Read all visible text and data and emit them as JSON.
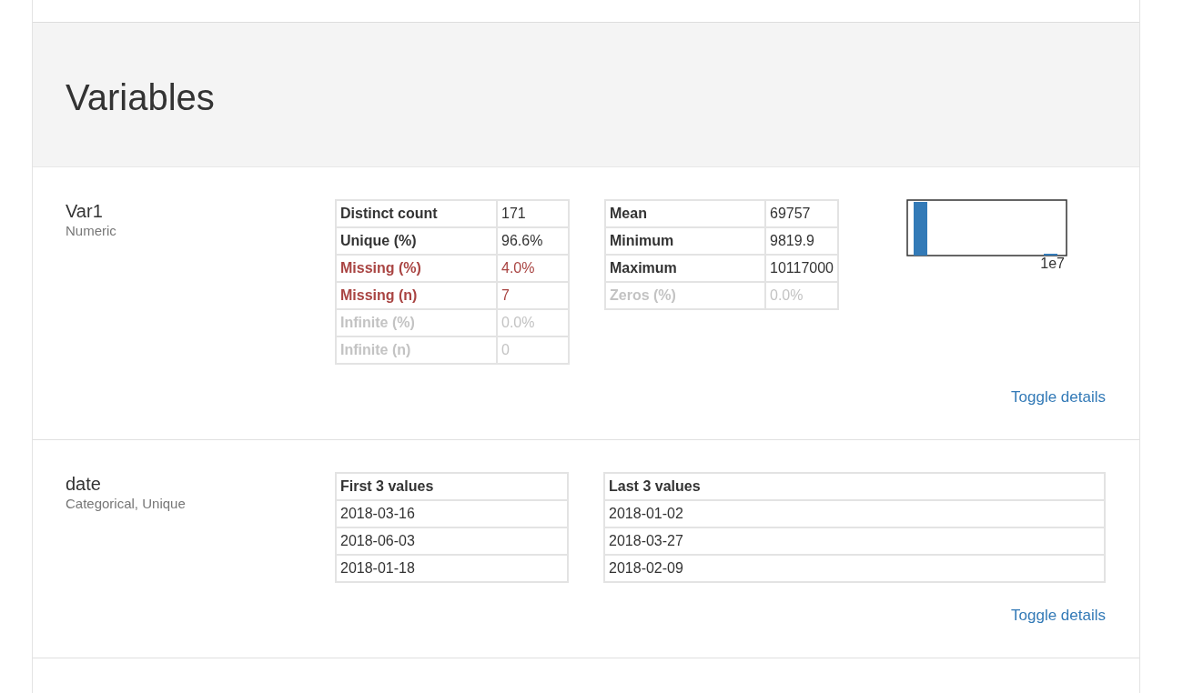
{
  "section": {
    "title": "Variables"
  },
  "variables": [
    {
      "kind": "numeric",
      "name": "Var1",
      "type": "Numeric",
      "tables": [
        {
          "rows": [
            {
              "label": "Distinct count",
              "value": "171",
              "kind": "normal"
            },
            {
              "label": "Unique (%)",
              "value": "96.6%",
              "kind": "normal"
            },
            {
              "label": "Missing (%)",
              "value": "4.0%",
              "kind": "alert"
            },
            {
              "label": "Missing (n)",
              "value": "7",
              "kind": "alert"
            },
            {
              "label": "Infinite (%)",
              "value": "0.0%",
              "kind": "ignore"
            },
            {
              "label": "Infinite (n)",
              "value": "0",
              "kind": "ignore"
            }
          ]
        },
        {
          "rows": [
            {
              "label": "Mean",
              "value": "69757",
              "kind": "normal"
            },
            {
              "label": "Minimum",
              "value": "9819.9",
              "kind": "normal"
            },
            {
              "label": "Maximum",
              "value": "10117000",
              "kind": "normal"
            },
            {
              "label": "Zeros (%)",
              "value": "0.0%",
              "kind": "ignore"
            }
          ]
        }
      ],
      "histogram": {
        "axis_label": "1e7"
      },
      "toggle": "Toggle details"
    },
    {
      "kind": "categorical",
      "name": "date",
      "type": "Categorical, Unique",
      "lists": [
        {
          "header": "First 3 values",
          "values": [
            "2018-03-16",
            "2018-06-03",
            "2018-01-18"
          ]
        },
        {
          "header": "Last 3 values",
          "values": [
            "2018-01-02",
            "2018-03-27",
            "2018-02-09"
          ]
        }
      ],
      "toggle": "Toggle details"
    }
  ]
}
